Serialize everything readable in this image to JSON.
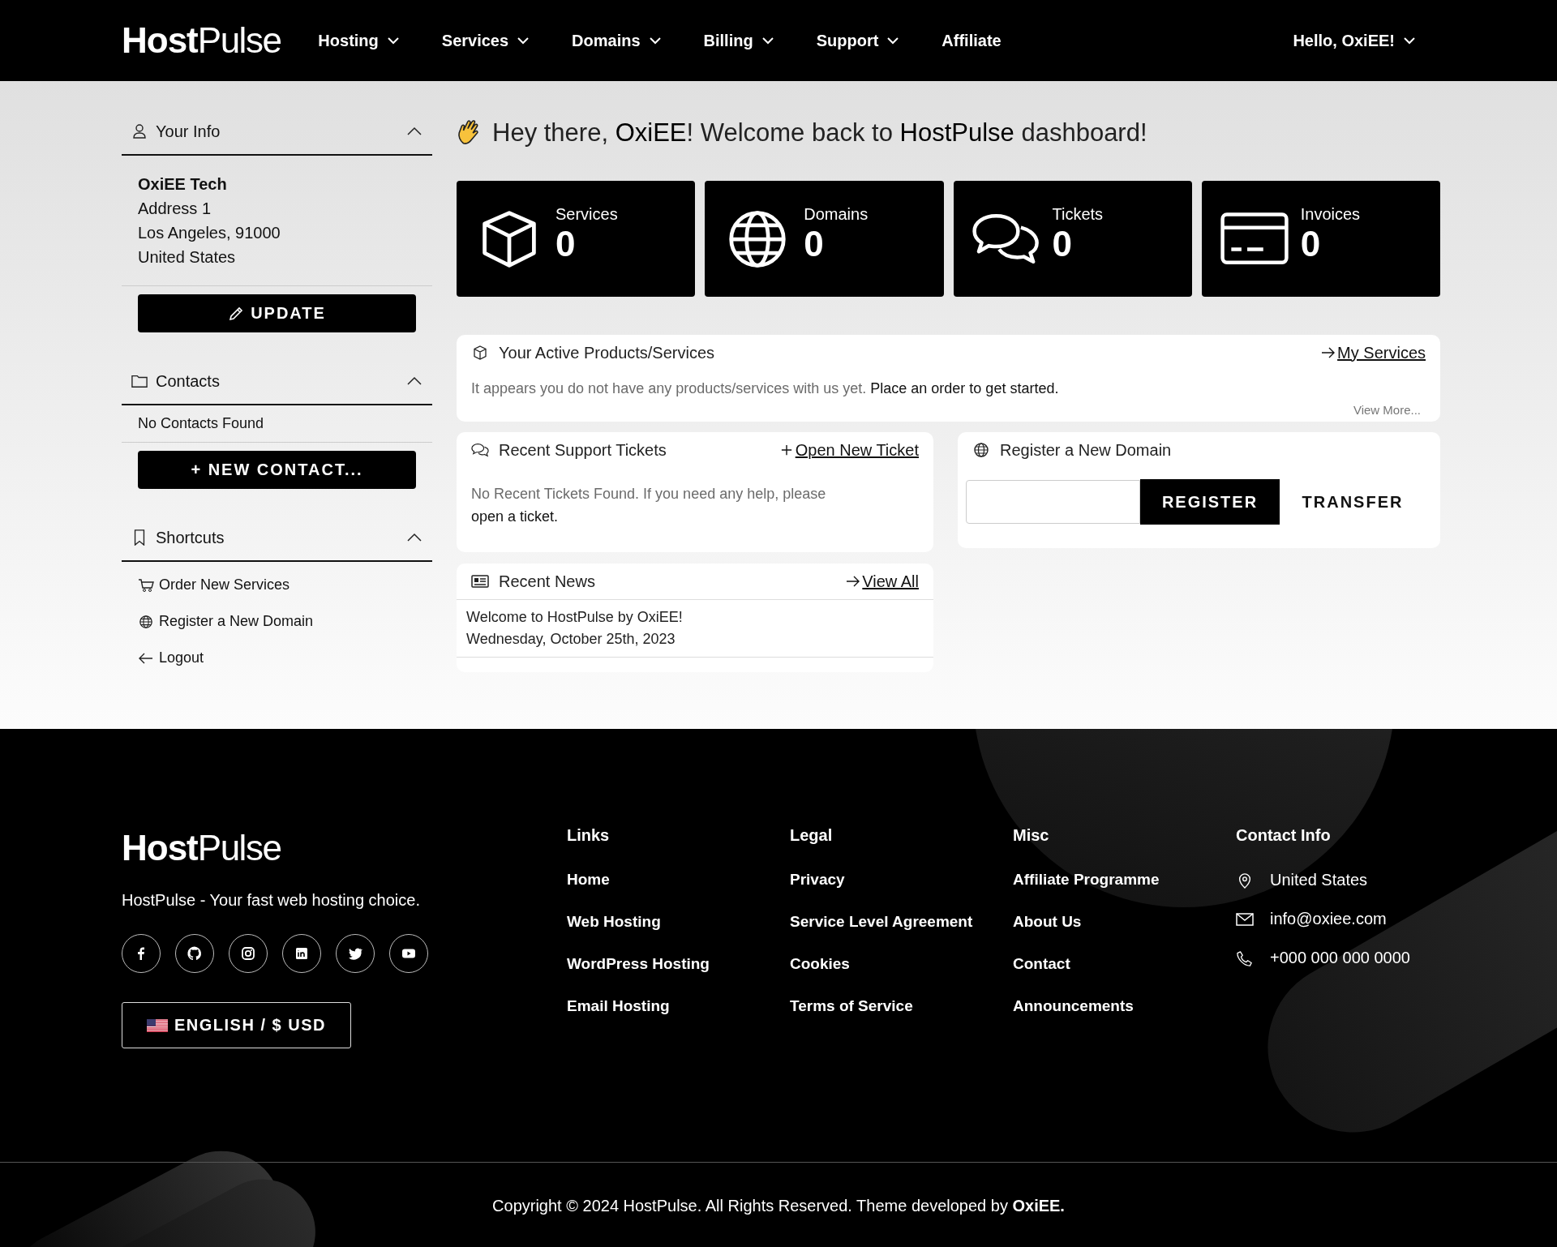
{
  "header": {
    "logo": "**Host**Pulse",
    "nav": [
      {
        "label": "Hosting",
        "has_menu": true
      },
      {
        "label": "Services",
        "has_menu": true
      },
      {
        "label": "Domains",
        "has_menu": true
      },
      {
        "label": "Billing",
        "has_menu": true
      },
      {
        "label": "Support",
        "has_menu": true
      },
      {
        "label": "Affiliate",
        "has_menu": false
      }
    ],
    "user_menu": {
      "label": "Hello, OxiEE!",
      "has_menu": true
    }
  },
  "sidebar": {
    "your_info": {
      "title": "Your Info",
      "expanded": true,
      "company": "OxiEE Tech",
      "address": [
        "Address 1",
        "Los Angeles, 91000",
        "United States"
      ],
      "button": "UPDATE"
    },
    "contacts": {
      "title": "Contacts",
      "expanded": true,
      "empty_text": "No Contacts Found",
      "button": "+ NEW CONTACT..."
    },
    "shortcuts": {
      "title": "Shortcuts",
      "expanded": true,
      "items": [
        {
          "kind": "cart",
          "label": "Order New Services"
        },
        {
          "kind": "globe",
          "label": "Register a New Domain"
        },
        {
          "kind": "back",
          "label": "Logout"
        }
      ]
    }
  },
  "greeting": "Hey there, **OxiEE**! Welcome back to **HostPulse** dashboard!",
  "stats": [
    {
      "kind": "box",
      "label": "Services",
      "count": "0"
    },
    {
      "kind": "globe",
      "label": "Domains",
      "count": "0"
    },
    {
      "kind": "chat",
      "label": "Tickets",
      "count": "0"
    },
    {
      "kind": "card",
      "label": "Invoices",
      "count": "0"
    }
  ],
  "products": {
    "title": "Your Active Products/Services",
    "link": "My Services",
    "message": "It appears you do not have any products/services with us yet.",
    "action": "Place an order to get started.",
    "more": "View More..."
  },
  "tickets": {
    "title": "Recent Support Tickets",
    "link": "Open New Ticket",
    "message": "No Recent Tickets Found. If you need any help, please",
    "action": "open a ticket."
  },
  "domain": {
    "title": "Register a New Domain",
    "register": "REGISTER",
    "transfer": "TRANSFER"
  },
  "news": {
    "title": "Recent News",
    "link": "View All",
    "items": [
      {
        "title": "Welcome to HostPulse by OxiEE!",
        "date": "Wednesday, October 25th, 2023"
      }
    ]
  },
  "footer": {
    "logo": "**Host**Pulse",
    "tagline": "HostPulse - Your fast web hosting choice.",
    "language": "ENGLISH / $ USD",
    "columns": [
      {
        "heading": "Links",
        "links": [
          "Home",
          "Web Hosting",
          "WordPress Hosting",
          "Email Hosting"
        ]
      },
      {
        "heading": "Legal",
        "links": [
          "Privacy",
          "Service Level Agreement",
          "Cookies",
          "Terms of Service"
        ]
      },
      {
        "heading": "Misc",
        "links": [
          "Affiliate Programme",
          "About Us",
          "Contact",
          "Announcements"
        ]
      }
    ],
    "contact": {
      "heading": "Contact Info",
      "items": [
        {
          "kind": "pin",
          "text": "United States"
        },
        {
          "kind": "mail",
          "text": "info@oxiee.com"
        },
        {
          "kind": "phone",
          "text": "+000 000 000 0000"
        }
      ]
    },
    "copyright": "Copyright © 2024 HostPulse. All Rights Reserved. Theme developed by **OxiEE.**"
  }
}
